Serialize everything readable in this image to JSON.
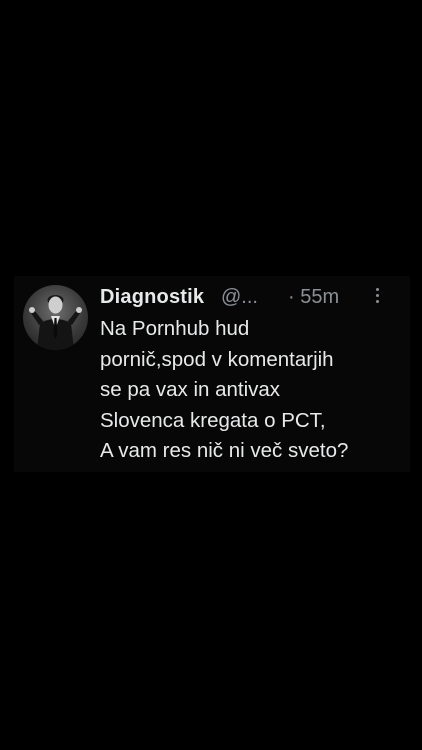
{
  "tweet": {
    "display_name": "Diagnostik",
    "handle": "@...",
    "timestamp": "· 55m",
    "text": "Na Pornhub hud\npornič,spod v komentarjih\nse pa vax in antivax\nSlovenca kregata o PCT,\nA vam res nič ni več sveto?",
    "avatar_icon": "person-in-suit-avatar",
    "more_icon": "more-vertical-icon"
  },
  "colors": {
    "background": "#000000",
    "text": "#e7e9ea",
    "secondary_text": "#8b9096"
  }
}
